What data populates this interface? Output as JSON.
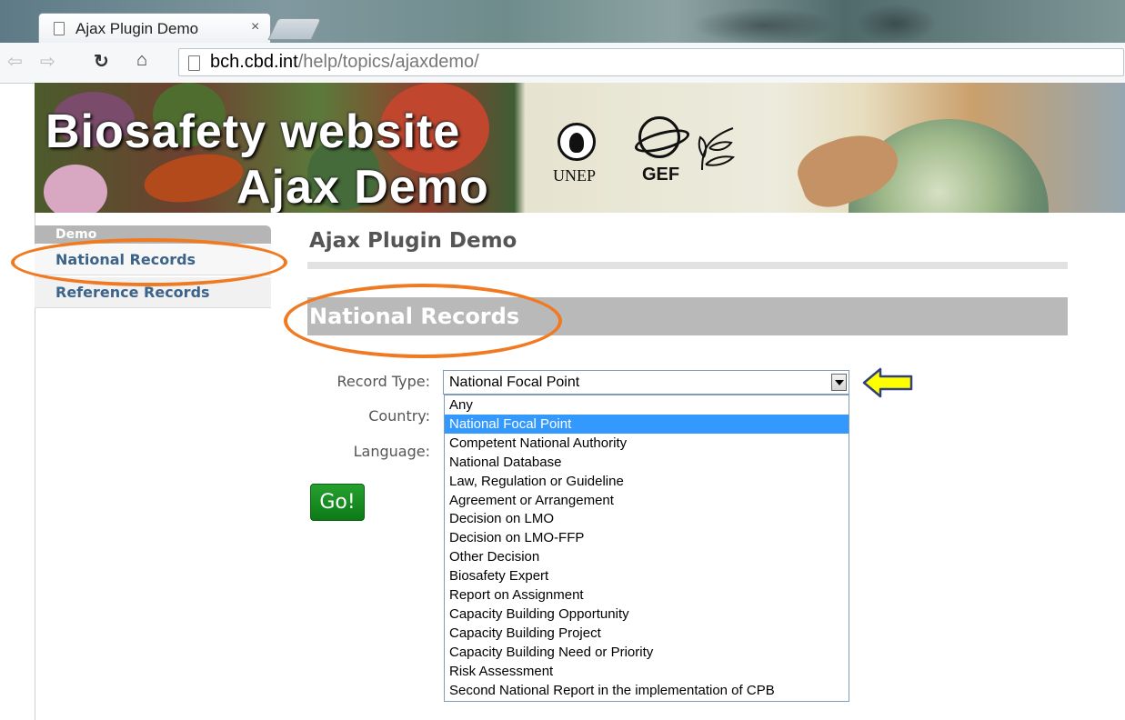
{
  "browser": {
    "tab_title": "Ajax Plugin Demo",
    "tab_close": "×",
    "url_host": "bch.cbd.int",
    "url_path": "/help/topics/ajaxdemo/"
  },
  "banner": {
    "title_line1": "Biosafety website",
    "title_line2": "Ajax Demo",
    "logo_unep": "UNEP",
    "logo_gef": "GEF"
  },
  "sidebar": {
    "header": "Demo",
    "items": [
      {
        "label": "National Records"
      },
      {
        "label": "Reference Records"
      }
    ]
  },
  "main": {
    "page_title": "Ajax Plugin Demo",
    "section_title": "National Records",
    "form": {
      "record_type_label": "Record Type:",
      "country_label": "Country:",
      "language_label": "Language:",
      "record_type_value": "National Focal Point",
      "options": [
        "Any",
        "National Focal Point",
        "Competent National Authority",
        "National Database",
        "Law, Regulation or Guideline",
        "Agreement or Arrangement",
        "Decision on LMO",
        "Decision on LMO-FFP",
        "Other Decision",
        "Biosafety Expert",
        "Report on Assignment",
        "Capacity Building Opportunity",
        "Capacity Building Project",
        "Capacity Building Need or Priority",
        "Risk Assessment",
        "Second National Report in the implementation of CPB"
      ],
      "selected_option_index": 1,
      "go_label": "Go!"
    }
  },
  "colors": {
    "annotation_ellipse": "#ef7a22",
    "annotation_arrow": "#ffff00",
    "selected_option": "#3399ff",
    "go_button": "#0d7a17"
  }
}
